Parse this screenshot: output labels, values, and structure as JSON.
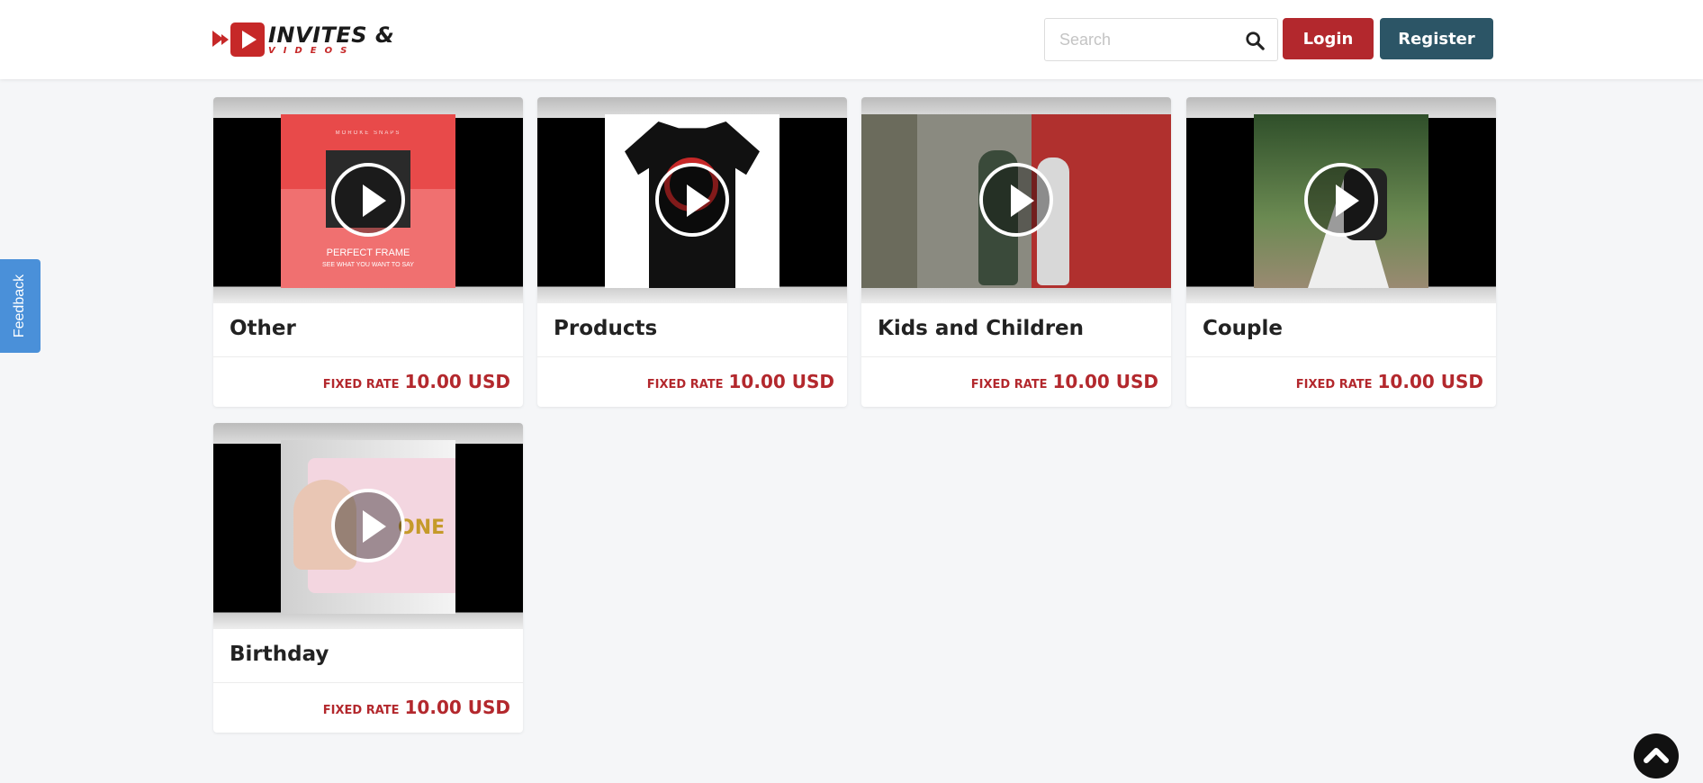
{
  "header": {
    "logo_line1": "INVITES &",
    "logo_line2": "VIDEOS",
    "search_placeholder": "Search",
    "login_label": "Login",
    "register_label": "Register"
  },
  "feedback_label": "Feedback",
  "cards": [
    {
      "title": "Other",
      "rate_label": "FIXED RATE",
      "rate_value": "10.00 USD",
      "thumb_text_top": "MOROKE SNAPS",
      "thumb_text_mid": "PERFECT FRAME",
      "thumb_text_bot": "SEE WHAT YOU WANT TO SAY"
    },
    {
      "title": "Products",
      "rate_label": "FIXED RATE",
      "rate_value": "10.00 USD"
    },
    {
      "title": "Kids and Children",
      "rate_label": "FIXED RATE",
      "rate_value": "10.00 USD"
    },
    {
      "title": "Couple",
      "rate_label": "FIXED RATE",
      "rate_value": "10.00 USD"
    },
    {
      "title": "Birthday",
      "rate_label": "FIXED RATE",
      "rate_value": "10.00 USD",
      "thumb_text_one": "ONE"
    }
  ],
  "colors": {
    "accent_red": "#b3282d",
    "register_teal": "#2c5566",
    "feedback_blue": "#4a90d9",
    "page_bg": "#f5f6f8"
  },
  "icons": {
    "search": "search-icon",
    "play": "play-icon",
    "scroll_top": "chevron-up-icon"
  }
}
